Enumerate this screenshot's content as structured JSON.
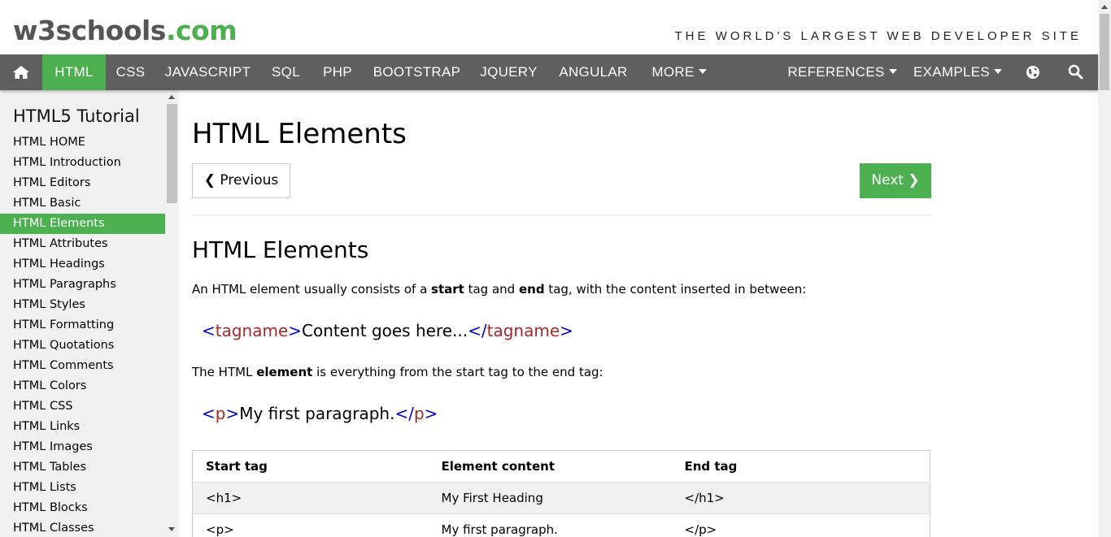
{
  "header": {
    "logo_main": "w3schools",
    "logo_suffix": ".com",
    "tagline": "THE WORLD'S LARGEST WEB DEVELOPER SITE"
  },
  "nav": {
    "items": [
      {
        "label": "HTML",
        "active": true
      },
      {
        "label": "CSS"
      },
      {
        "label": "JAVASCRIPT"
      },
      {
        "label": "SQL"
      },
      {
        "label": "PHP"
      },
      {
        "label": "BOOTSTRAP"
      },
      {
        "label": "JQUERY"
      },
      {
        "label": "ANGULAR"
      },
      {
        "label": "MORE",
        "dropdown": true
      }
    ],
    "right_items": [
      {
        "label": "REFERENCES",
        "dropdown": true
      },
      {
        "label": "EXAMPLES",
        "dropdown": true
      }
    ],
    "icons": [
      "home-icon",
      "globe-icon",
      "search-icon"
    ],
    "accent_color": "#4CAF50",
    "bar_color": "#5f5f5f"
  },
  "sidebar": {
    "title": "HTML5 Tutorial",
    "items": [
      {
        "label": "HTML HOME"
      },
      {
        "label": "HTML Introduction"
      },
      {
        "label": "HTML Editors"
      },
      {
        "label": "HTML Basic"
      },
      {
        "label": "HTML Elements",
        "active": true
      },
      {
        "label": "HTML Attributes"
      },
      {
        "label": "HTML Headings"
      },
      {
        "label": "HTML Paragraphs"
      },
      {
        "label": "HTML Styles"
      },
      {
        "label": "HTML Formatting"
      },
      {
        "label": "HTML Quotations"
      },
      {
        "label": "HTML Comments"
      },
      {
        "label": "HTML Colors"
      },
      {
        "label": "HTML CSS"
      },
      {
        "label": "HTML Links"
      },
      {
        "label": "HTML Images"
      },
      {
        "label": "HTML Tables"
      },
      {
        "label": "HTML Lists"
      },
      {
        "label": "HTML Blocks"
      },
      {
        "label": "HTML Classes"
      }
    ]
  },
  "main": {
    "title": "HTML Elements",
    "prev_label": "❮ Previous",
    "next_label": "Next ❯",
    "section_title": "HTML Elements",
    "intro": {
      "part1": "An HTML element usually consists of a ",
      "bold1": "start",
      "part2": " tag and ",
      "bold2": "end",
      "part3": " tag, with the content inserted in between:"
    },
    "code1": {
      "open_lt": "<",
      "open_name": "tagname",
      "open_gt": ">",
      "content": "Content goes here...",
      "close_lt": "</",
      "close_name": "tagname",
      "close_gt": ">"
    },
    "element_para": {
      "part1": "The HTML ",
      "bold": "element",
      "part2": " is everything from the start tag to the end tag:"
    },
    "code2": {
      "open_lt": "<",
      "open_name": "p",
      "open_gt": ">",
      "content": "My first paragraph.",
      "close_lt": "</",
      "close_name": "p",
      "close_gt": ">"
    },
    "table": {
      "headers": [
        "Start tag",
        "Element content",
        "End tag"
      ],
      "rows": [
        [
          "<h1>",
          "My First Heading",
          "</h1>"
        ],
        [
          "<p>",
          "My first paragraph.",
          "</p>"
        ]
      ]
    }
  }
}
